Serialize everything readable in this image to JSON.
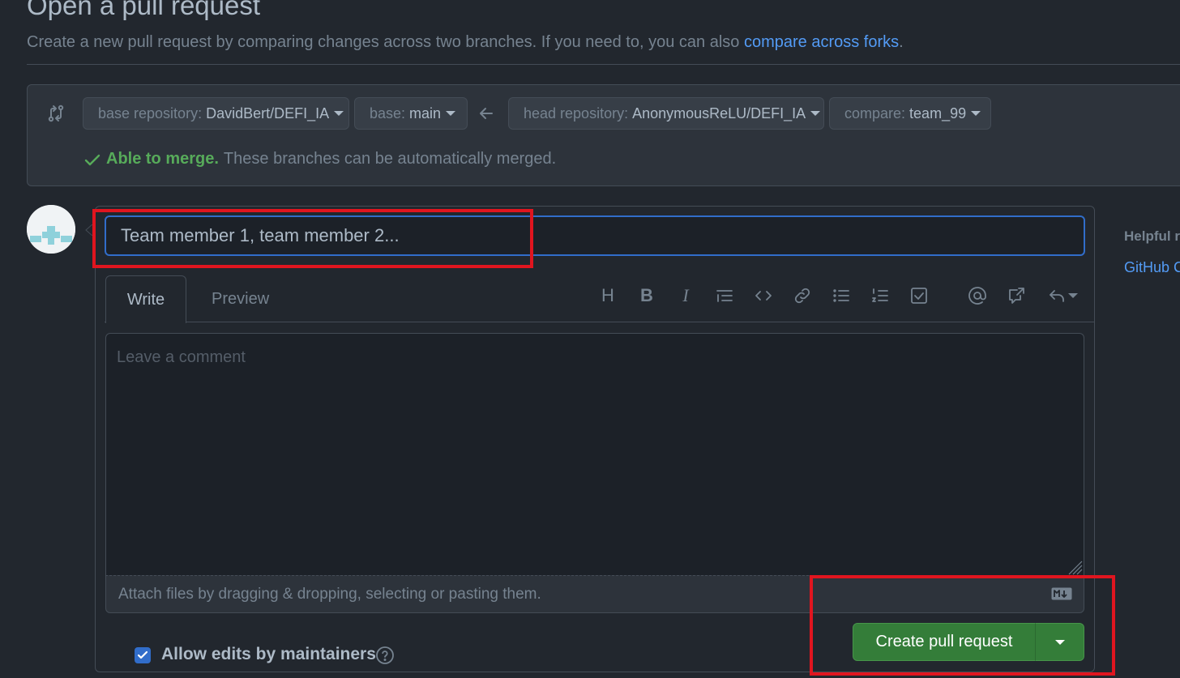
{
  "header": {
    "title": "Open a pull request",
    "subtitle": "Create a new pull request by comparing changes across two branches. If you need to, you can also",
    "compare_link": "compare across forks",
    "subtitle_end": "."
  },
  "compare": {
    "base_repository": {
      "label": "base repository:",
      "value": "DavidBert/DEFI_IA"
    },
    "base": {
      "label": "base:",
      "value": "main"
    },
    "head_repository": {
      "label": "head repository:",
      "value": "AnonymousReLU/DEFI_IA"
    },
    "compare": {
      "label": "compare:",
      "value": "team_99"
    },
    "merge_status": "Able to merge.",
    "merge_note": "These branches can be automatically merged."
  },
  "form": {
    "title_value": "Team member 1, team member 2...",
    "tabs": [
      "Write",
      "Preview"
    ],
    "toolbar_heading": "H",
    "toolbar_bold": "B",
    "toolbar_italic": "I",
    "comment_placeholder": "Leave a comment",
    "attach_text": "Attach files by dragging & dropping, selecting or pasting them.",
    "allow_edits": "Allow edits by maintainers",
    "allow_edits_checked": true,
    "create_button": "Create pull request"
  },
  "sidebar": {
    "heading": "Helpful r",
    "link": "GitHub C"
  },
  "colors": {
    "background": "#22272e",
    "accent_link": "#539bf5",
    "success": "#57ab5a",
    "primary_button": "#347d39",
    "highlight": "#e0151f"
  }
}
